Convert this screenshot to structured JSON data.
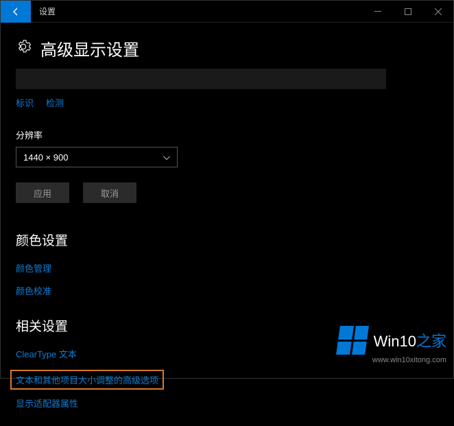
{
  "titlebar": {
    "title": "设置"
  },
  "page": {
    "title": "高级显示设置"
  },
  "links": {
    "identify": "标识",
    "detect": "检测"
  },
  "resolution": {
    "label": "分辨率",
    "value": "1440 × 900"
  },
  "buttons": {
    "apply": "应用",
    "cancel": "取消"
  },
  "color_section": {
    "heading": "颜色设置",
    "color_mgmt": "颜色管理",
    "color_calib": "颜色校准"
  },
  "related_section": {
    "heading": "相关设置",
    "cleartype": "ClearType 文本",
    "text_sizing": "文本和其他项目大小调整的高级选项",
    "adapter": "显示适配器属性"
  },
  "watermark": {
    "brand_a": "Win10",
    "brand_b": "之家",
    "url": "www.win10xitong.com"
  }
}
